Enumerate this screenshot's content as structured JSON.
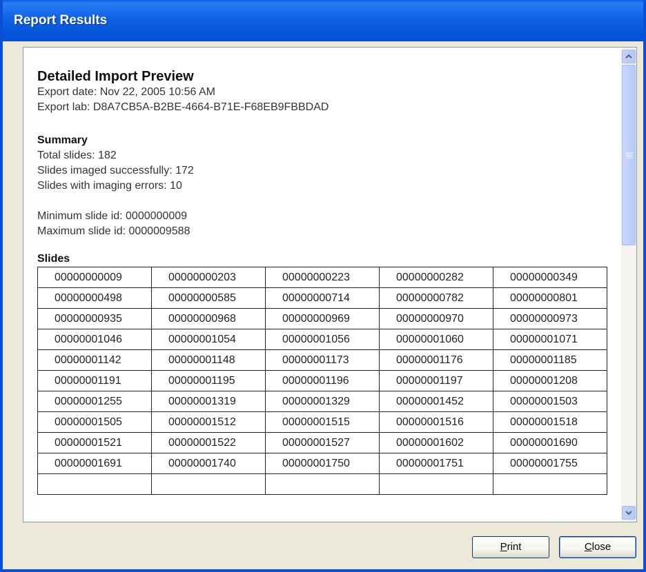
{
  "window": {
    "title": "Report Results"
  },
  "report": {
    "heading": "Detailed Import Preview",
    "export_date": "Export date: Nov 22, 2005 10:56 AM",
    "export_lab": "Export lab: D8A7CB5A-B2BE-4664-B71E-F68EB9FBBDAD",
    "summary_heading": "Summary",
    "total_slides": "Total slides: 182",
    "imaged_ok": "Slides imaged successfully: 172",
    "imaging_errors": "Slides with imaging errors: 10",
    "min_slide": "Minimum slide id: 0000000009",
    "max_slide": "Maximum slide id: 0000009588",
    "slides_heading": "Slides",
    "slides": [
      [
        "00000000009",
        "00000000203",
        "00000000223",
        "00000000282",
        "00000000349"
      ],
      [
        "00000000498",
        "00000000585",
        "00000000714",
        "00000000782",
        "00000000801"
      ],
      [
        "00000000935",
        "00000000968",
        "00000000969",
        "00000000970",
        "00000000973"
      ],
      [
        "00000001046",
        "00000001054",
        "00000001056",
        "00000001060",
        "00000001071"
      ],
      [
        "00000001142",
        "00000001148",
        "00000001173",
        "00000001176",
        "00000001185"
      ],
      [
        "00000001191",
        "00000001195",
        "00000001196",
        "00000001197",
        "00000001208"
      ],
      [
        "00000001255",
        "00000001319",
        "00000001329",
        "00000001452",
        "00000001503"
      ],
      [
        "00000001505",
        "00000001512",
        "00000001515",
        "00000001516",
        "00000001518"
      ],
      [
        "00000001521",
        "00000001522",
        "00000001527",
        "00000001602",
        "00000001690"
      ],
      [
        "00000001691",
        "00000001740",
        "00000001750",
        "00000001751",
        "00000001755"
      ],
      [
        "",
        "",
        "",
        "",
        ""
      ]
    ]
  },
  "buttons": {
    "print": "Print",
    "close": "Close"
  },
  "icons": {
    "scroll_up": "chevron-up-icon",
    "scroll_down": "chevron-down-icon"
  }
}
